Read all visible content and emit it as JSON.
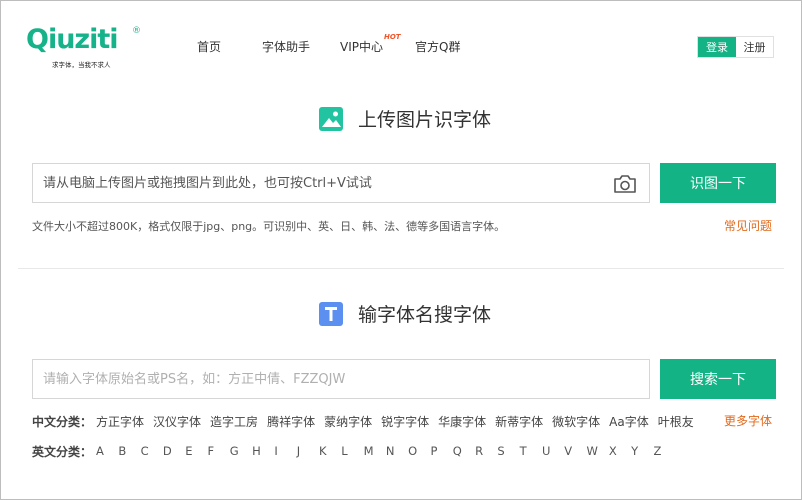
{
  "brand": {
    "logo_text": "Qiuziti",
    "registered": "®",
    "slogan": "求字体，当我不求人"
  },
  "nav": {
    "items": [
      "首页",
      "字体助手",
      "VIP中心",
      "官方Q群"
    ],
    "hot_badge": "HOT"
  },
  "auth": {
    "login": "登录",
    "register": "注册"
  },
  "upload_section": {
    "title": "上传图片识字体",
    "placeholder": "请从电脑上传图片或拖拽图片到此处，也可按Ctrl+V试试",
    "button": "识图一下",
    "hint": "文件大小不超过800K，格式仅限于jpg、png。可识别中、英、日、韩、法、德等多国语言字体。",
    "faq_link": "常见问题"
  },
  "search_section": {
    "title": "输字体名搜字体",
    "placeholder": "请输入字体原始名或PS名，如：方正中倩、FZZQJW",
    "button": "搜索一下"
  },
  "categories": {
    "chinese_label": "中文分类：",
    "chinese": [
      "方正字体",
      "汉仪字体",
      "造字工房",
      "腾祥字体",
      "蒙纳字体",
      "锐字字体",
      "华康字体",
      "新蒂字体",
      "微软字体",
      "Aa字体",
      "叶根友"
    ],
    "more": "更多字体",
    "english_label": "英文分类：",
    "letters": [
      "A",
      "B",
      "C",
      "D",
      "E",
      "F",
      "G",
      "H",
      "I",
      "J",
      "K",
      "L",
      "M",
      "N",
      "O",
      "P",
      "Q",
      "R",
      "S",
      "T",
      "U",
      "V",
      "W",
      "X",
      "Y",
      "Z"
    ]
  },
  "colors": {
    "brand": "#14b386",
    "accent_link": "#e16a1c",
    "hot": "#f0552a"
  },
  "icons": {
    "upload_title": "image-icon",
    "search_title": "text-t-icon",
    "camera": "camera-icon"
  }
}
